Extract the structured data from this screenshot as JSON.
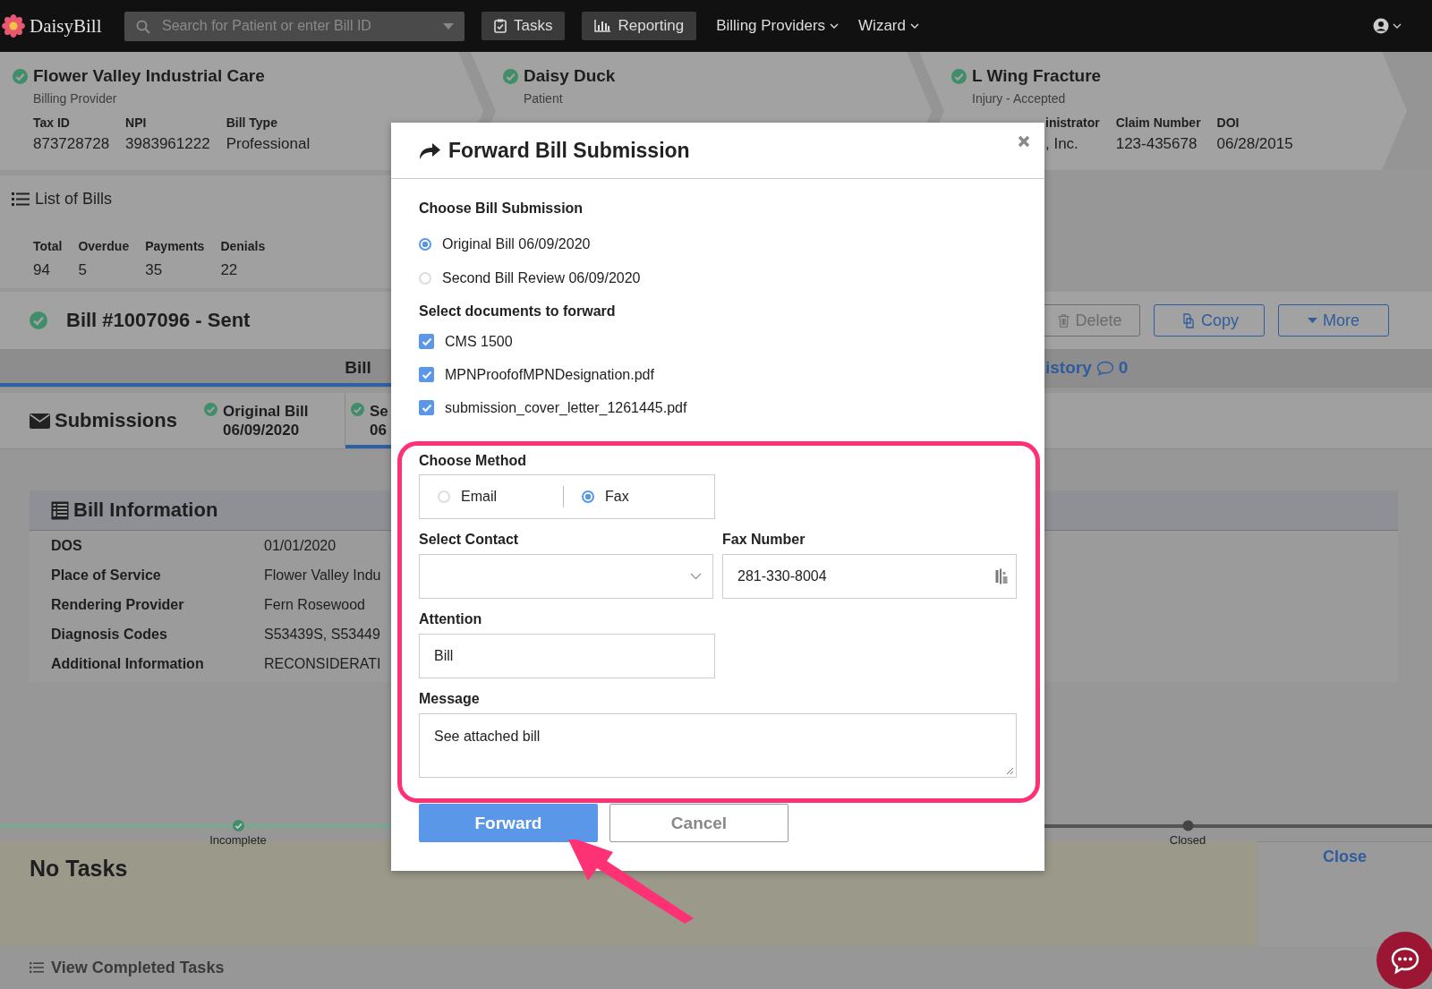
{
  "nav": {
    "logo": "DaisyBill",
    "search": {
      "placeholder": "Search for Patient or enter Bill ID"
    },
    "items": [
      {
        "label": "Tasks",
        "kind": "tasks"
      },
      {
        "label": "Reporting",
        "kind": "reporting"
      },
      {
        "label": "Billing Providers",
        "kind": "dropdown"
      },
      {
        "label": "Wizard",
        "kind": "dropdown"
      }
    ]
  },
  "breadcrumbs": [
    {
      "title": "Flower Valley Industrial Care",
      "subtitle": "Billing Provider",
      "fields": [
        {
          "label": "Tax ID",
          "value": "873728728"
        },
        {
          "label": "NPI",
          "value": "3983961222"
        },
        {
          "label": "Bill Type",
          "value": "Professional"
        }
      ]
    },
    {
      "title": "Daisy Duck",
      "subtitle": "Patient"
    },
    {
      "title": "L Wing Fracture",
      "subtitle": "Injury - Accepted",
      "fields": [
        {
          "label": "inistrator",
          "value": ", Inc."
        },
        {
          "label": "Claim Number",
          "value": "123-435678"
        },
        {
          "label": "DOI",
          "value": "06/28/2015"
        }
      ]
    }
  ],
  "bills_summary": {
    "title": "List of Bills",
    "stats": [
      {
        "label": "Total",
        "value": "94"
      },
      {
        "label": "Overdue",
        "value": "5"
      },
      {
        "label": "Payments",
        "value": "35"
      },
      {
        "label": "Denials",
        "value": "22"
      }
    ]
  },
  "bill": {
    "title": "Bill #1007096 - Sent",
    "actions": [
      {
        "label": "Delete",
        "kind": "delete",
        "disabled": true
      },
      {
        "label": "Copy",
        "kind": "copy",
        "disabled": false
      },
      {
        "label": "More",
        "kind": "more",
        "disabled": false
      }
    ]
  },
  "tabs": [
    {
      "label": "Bill",
      "selected": true
    },
    {
      "label": "istory",
      "count": "0",
      "selected": false
    }
  ],
  "submissions": {
    "title": "Submissions",
    "tabs": [
      {
        "label": "Original Bill",
        "date": "06/09/2020",
        "selected": false
      },
      {
        "label": "Se",
        "date": "06",
        "selected": true
      }
    ]
  },
  "bill_information": {
    "title": "Bill Information",
    "rows": [
      {
        "label": "DOS",
        "value": "01/01/2020"
      },
      {
        "label": "Place of Service",
        "value": "Flower Valley Indu"
      },
      {
        "label": "Rendering Provider",
        "value": "Fern Rosewood"
      },
      {
        "label": "Diagnosis Codes",
        "value": "S53439S, S53449"
      },
      {
        "label": "Additional Information",
        "value": "RECONSIDERATI"
      }
    ]
  },
  "progress": {
    "steps": [
      {
        "label": "Incomplete",
        "done": true
      },
      {
        "label": "Closed",
        "done": false
      }
    ]
  },
  "tasks": {
    "title": "No Tasks",
    "close": "Close",
    "footer": "View Completed Tasks"
  },
  "modal": {
    "title": "Forward Bill Submission",
    "submission_label": "Choose Bill Submission",
    "submissions": [
      {
        "label": "Original Bill 06/09/2020",
        "selected": true
      },
      {
        "label": "Second Bill Review 06/09/2020",
        "selected": false
      }
    ],
    "documents_label": "Select documents to forward",
    "documents": [
      {
        "label": "CMS 1500",
        "checked": true
      },
      {
        "label": "MPNProofofMPNDesignation.pdf",
        "checked": true
      },
      {
        "label": "submission_cover_letter_1261445.pdf",
        "checked": true
      }
    ],
    "method_label": "Choose Method",
    "methods": [
      {
        "label": "Email",
        "selected": false
      },
      {
        "label": "Fax",
        "selected": true
      }
    ],
    "contact": {
      "label": "Select Contact"
    },
    "fax": {
      "label": "Fax Number",
      "value": "281-330-8004"
    },
    "attention": {
      "label": "Attention",
      "value": "Bill"
    },
    "message": {
      "label": "Message",
      "value": "See attached bill"
    },
    "buttons": [
      {
        "label": "Forward",
        "kind": "primary"
      },
      {
        "label": "Cancel",
        "kind": "secondary"
      }
    ]
  }
}
